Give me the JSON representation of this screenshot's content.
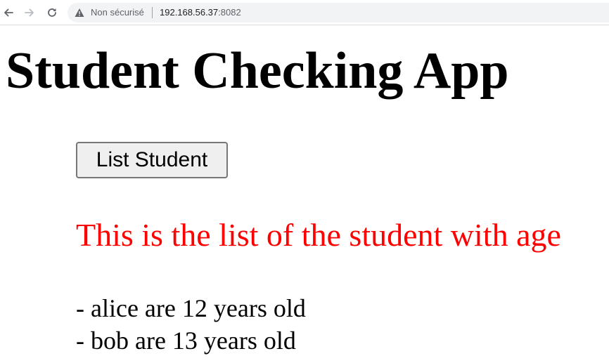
{
  "browser": {
    "security_label": "Non sécurisé",
    "url_host": "192.168.56.37",
    "url_port": ":8082"
  },
  "page": {
    "title": "Student Checking App",
    "list_button_label": "List Student",
    "list_heading": "This is the list of the student with age",
    "students": [
      "- alice are 12 years old",
      "- bob are 13 years old"
    ]
  },
  "colors": {
    "heading_accent": "#ff0000"
  },
  "icons": {
    "back": "arrow-left-icon",
    "forward": "arrow-right-icon",
    "reload": "reload-icon",
    "security": "warning-triangle-icon"
  }
}
